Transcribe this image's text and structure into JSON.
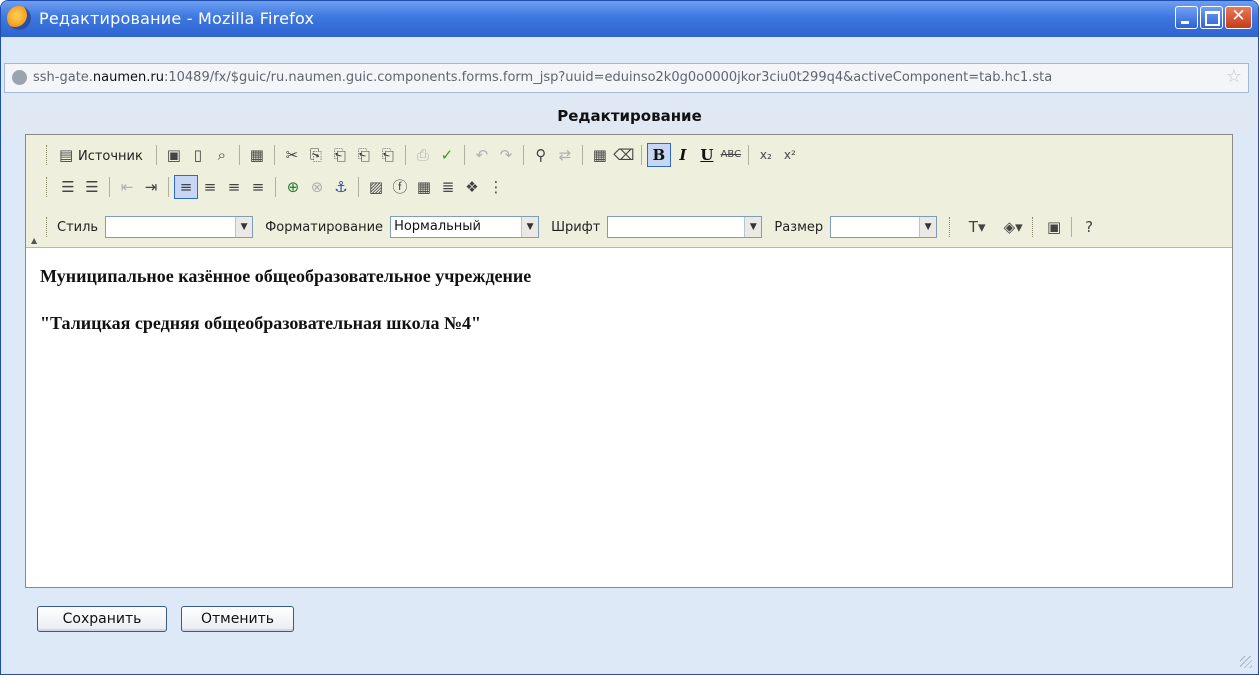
{
  "window": {
    "title": "Редактирование - Mozilla Firefox"
  },
  "address_bar": {
    "url_prefix": "ssh-gate.",
    "url_domain": "naumen.ru",
    "url_rest": ":10489/fx/$guic/ru.naumen.guic.components.forms.form_jsp?uuid=eduinso2k0g0o0000jkor3ciu0t299q4&activeComponent=tab.hc1.sta"
  },
  "page": {
    "title": "Редактирование"
  },
  "toolbar": {
    "source_label": "Источник",
    "style_label": "Стиль",
    "style_value": "",
    "format_label": "Форматирование",
    "format_value": "Нормальный",
    "font_label": "Шрифт",
    "font_value": "",
    "size_label": "Размер",
    "size_value": "",
    "bold_active": true
  },
  "document": {
    "paragraphs": [
      "Муниципальное казённое общеобразовательное учреждение",
      "\"Талицкая средняя общеобразовательная школа №4\""
    ]
  },
  "buttons": {
    "save": "Сохранить",
    "cancel": "Отменить"
  }
}
